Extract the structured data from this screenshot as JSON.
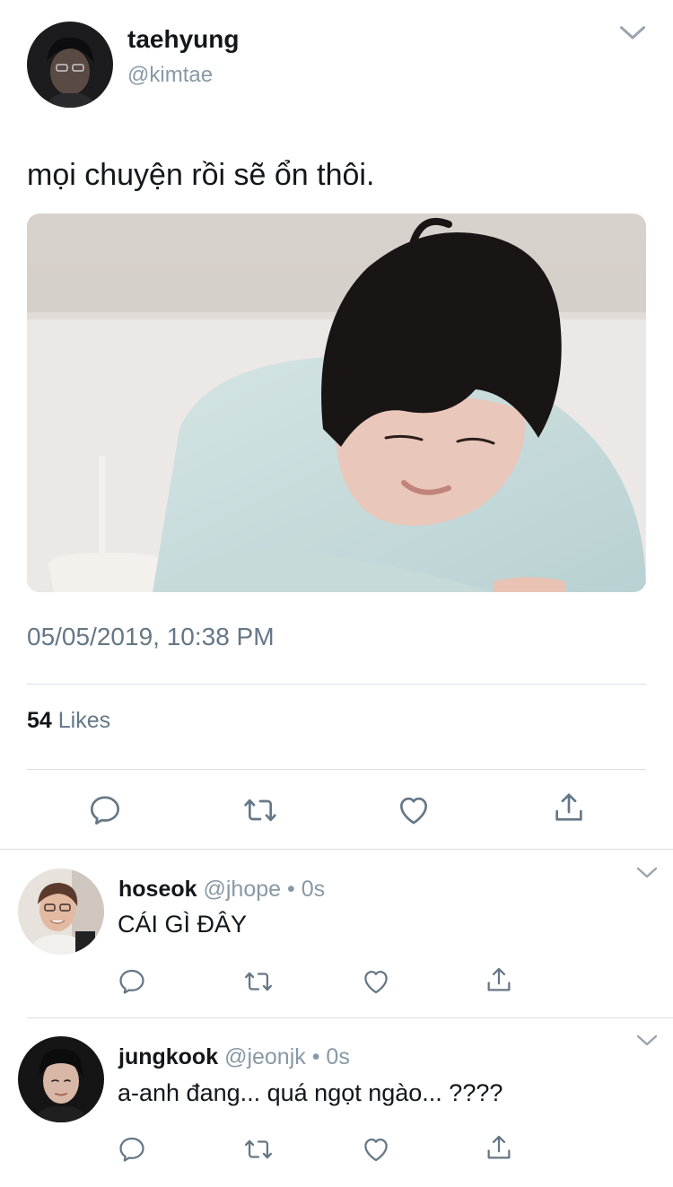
{
  "tweet": {
    "author_name": "taehyung",
    "author_handle": "@kimtae",
    "text": "mọi chuyện rồi sẽ ổn thôi.",
    "timestamp": "05/05/2019, 10:38 PM",
    "likes_count": "54",
    "likes_label": "Likes"
  },
  "replies": [
    {
      "name": "hoseok",
      "handle": "@jhope",
      "time": "• 0s",
      "text": "CÁI GÌ ĐÂY"
    },
    {
      "name": "jungkook",
      "handle": "@jeonjk",
      "time": "• 0s",
      "text": "a-anh đang... quá ngọt ngào... ????"
    }
  ],
  "icons": {
    "reply": "reply-icon",
    "retweet": "retweet-icon",
    "like": "heart-icon",
    "share": "share-icon",
    "menu": "chevron-down-icon"
  },
  "colors": {
    "text_primary": "#14171a",
    "text_secondary": "#657786",
    "divider": "#d9dfe3"
  }
}
